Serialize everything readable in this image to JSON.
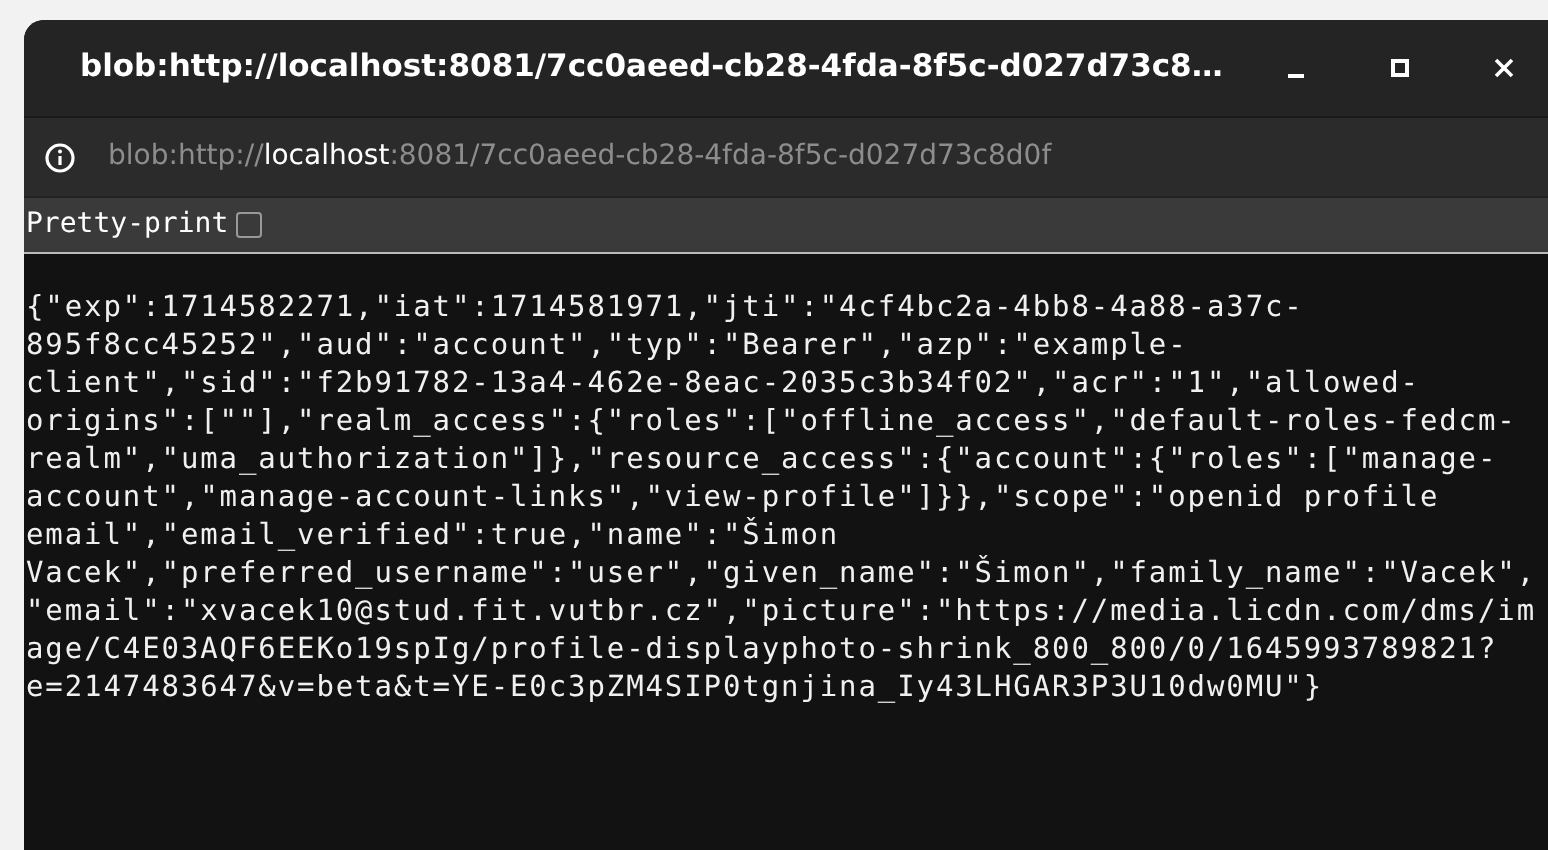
{
  "window": {
    "title": "blob:http://localhost:8081/7cc0aeed-cb28-4fda-8f5c-d027d73c8…"
  },
  "address_bar": {
    "scheme": "blob:http://",
    "host": "localhost",
    "rest": ":8081/7cc0aeed-cb28-4fda-8f5c-d027d73c8d0f"
  },
  "pretty_print": {
    "label": "Pretty-print",
    "checked": false
  },
  "content_lines": [
    "{\"exp\":1714582271,\"iat\":1714581971,\"jti\":\"4cf4bc2a-4bb8-4a88-a37c-",
    "895f8cc45252\",\"aud\":\"account\",\"typ\":\"Bearer\",\"azp\":\"example-",
    "client\",\"sid\":\"f2b91782-13a4-462e-8eac-2035c3b34f02\",\"acr\":\"1\",\"allowed-",
    "origins\":[\"\"],\"realm_access\":{\"roles\":[\"offline_access\",\"default-roles-fedcm-",
    "realm\",\"uma_authorization\"]},\"resource_access\":{\"account\":{\"roles\":[\"manage-",
    "account\",\"manage-account-links\",\"view-profile\"]}},\"scope\":\"openid profile",
    "email\",\"email_verified\":true,\"name\":\"Šimon",
    "Vacek\",\"preferred_username\":\"user\",\"given_name\":\"Šimon\",\"family_name\":\"Vacek\",",
    "\"email\":\"xvacek10@stud.fit.vutbr.cz\",\"picture\":\"https://media.licdn.com/dms/im",
    "age/C4E03AQF6EEKo19spIg/profile-displayphoto-shrink_800_800/0/1645993789821?",
    "e=2147483647&v=beta&t=YE-E0c3pZM4SIP0tgnjina_Iy43LHGAR3P3U10dw0MU\"}"
  ]
}
